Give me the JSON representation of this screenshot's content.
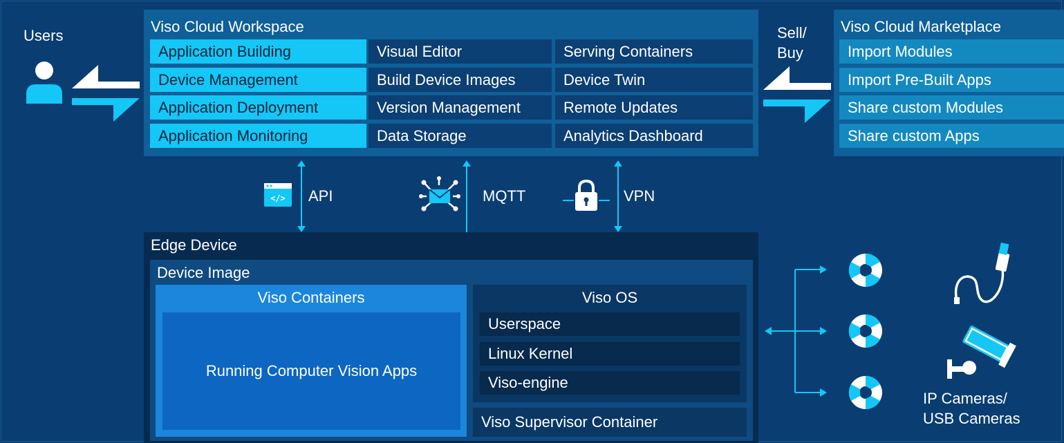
{
  "users": {
    "label": "Users"
  },
  "workspace": {
    "title": "Viso Cloud Workspace",
    "col1": [
      "Application Building",
      "Device Management",
      "Application Deployment",
      "Application Monitoring"
    ],
    "col2": [
      "Visual Editor",
      "Build Device Images",
      "Version Management",
      "Data Storage"
    ],
    "col3": [
      "Serving Containers",
      "Device Twin",
      "Remote Updates",
      "Analytics Dashboard"
    ]
  },
  "sell_buy": {
    "line1": "Sell/",
    "line2": "Buy"
  },
  "marketplace": {
    "title": "Viso Cloud Marketplace",
    "items": [
      "Import Modules",
      "Import Pre-Built Apps",
      "Share custom Modules",
      "Share custom Apps"
    ]
  },
  "connections": {
    "api": "API",
    "mqtt": "MQTT",
    "vpn": "VPN"
  },
  "edge": {
    "title": "Edge Device",
    "image_title": "Device Image",
    "containers_title": "Viso Containers",
    "running": "Running Computer Vision Apps",
    "os_title": "Viso OS",
    "os_items": [
      "Userspace",
      "Linux Kernel",
      "Viso-engine"
    ],
    "supervisor": "Viso Supervisor Container"
  },
  "cameras": {
    "line1": "IP Cameras/",
    "line2": "USB Cameras"
  },
  "colors": {
    "background": "#0a3d72",
    "accent": "#14c7f6",
    "panel": "#0f5f98",
    "container_blue": "#1b86dc"
  }
}
